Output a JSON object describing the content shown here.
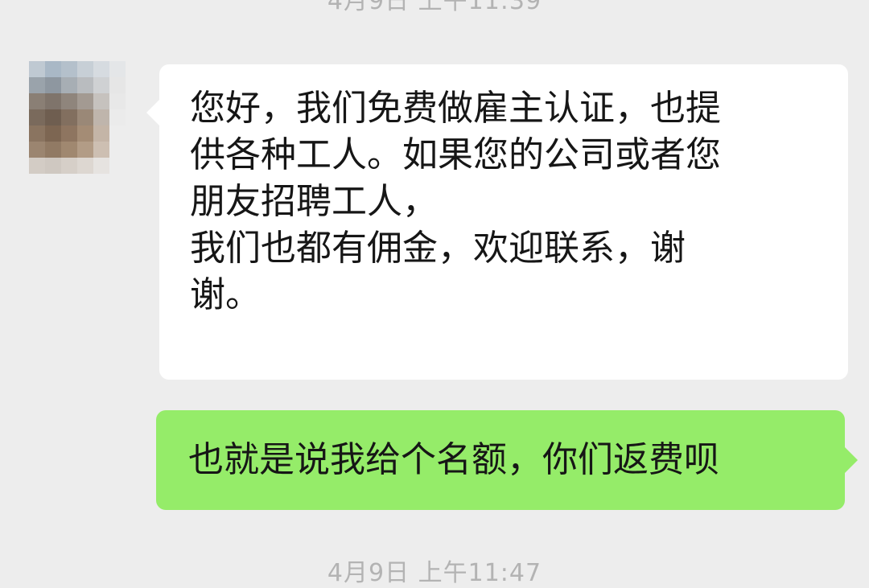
{
  "chat": {
    "timestamp_top": "4月9日 上午11:39",
    "timestamp_bottom": "4月9日 上午11:47",
    "incoming": {
      "lines": [
        "您好，我们免费做雇主认证，也提",
        "供各种工人。如果您的公司或者您",
        "朋友招聘工人，",
        "我们也都有佣金，欢迎联系，谢",
        "谢。"
      ]
    },
    "outgoing": {
      "text": "也就是说我给个名额，你们返费呗"
    }
  },
  "avatar": {
    "icon": "pixelated-avatar-icon",
    "palette": [
      "#bfc9d2",
      "#a9b8c6",
      "#b4c0cb",
      "#c7cfd6",
      "#d6dbe0",
      "#e4e6e8",
      "#9aa3ab",
      "#8e97a0",
      "#a7aeb4",
      "#b9bcbf",
      "#cfd1d3",
      "#e6e6e6",
      "#8a7f75",
      "#7f746b",
      "#8f857c",
      "#a39a92",
      "#c6c2be",
      "#e8e8e8",
      "#7a6a5c",
      "#6f5e50",
      "#826f5f",
      "#9a8877",
      "#bfb5ac",
      "#ebebeb",
      "#8a7460",
      "#7d6652",
      "#8e7560",
      "#a48c75",
      "#c4b5a7",
      "#ededed",
      "#9b8570",
      "#917a64",
      "#a08870",
      "#b29c86",
      "#cdbfb2",
      "#ededed",
      "#d3ccc5",
      "#cfc8c1",
      "#d6cfc8",
      "#ddd7d1",
      "#e6e3e0",
      "#ededed"
    ]
  }
}
